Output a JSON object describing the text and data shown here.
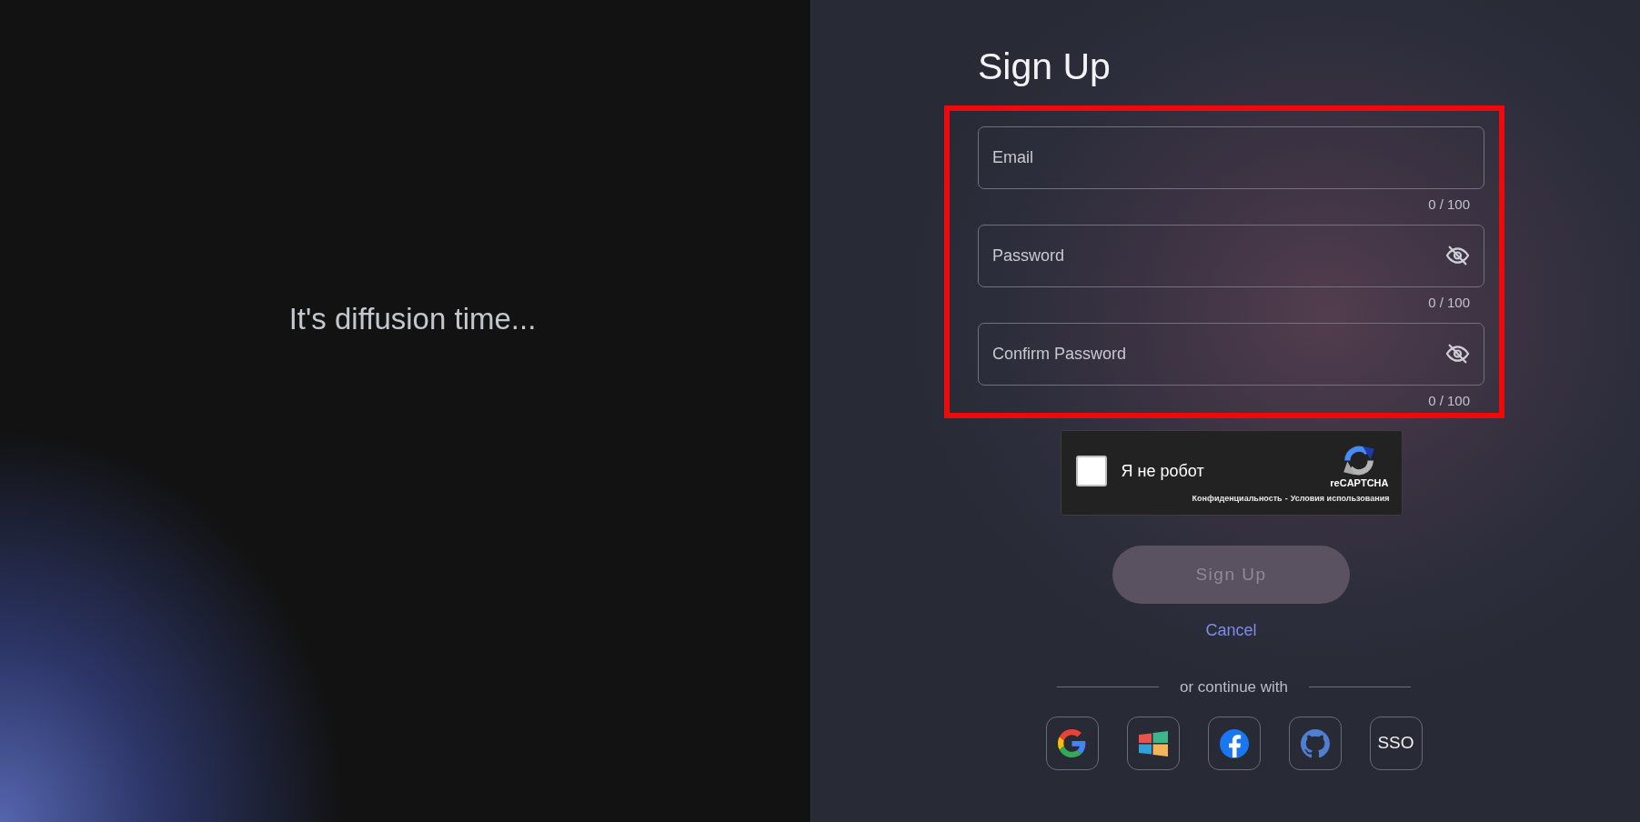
{
  "left_panel": {
    "tagline": "It's diffusion time..."
  },
  "form": {
    "title": "Sign Up",
    "fields_highlighted": true,
    "fields": [
      {
        "kind": "email",
        "placeholder": "Email",
        "counter": "0 / 100"
      },
      {
        "kind": "password",
        "placeholder": "Password",
        "counter": "0 / 100"
      },
      {
        "kind": "password",
        "placeholder": "Confirm Password",
        "counter": "0 / 100"
      }
    ],
    "captcha": {
      "checked": false,
      "label": "Я не робот",
      "brand": "reCAPTCHA",
      "links": [
        "Конфиденциальность",
        "Условия использования"
      ],
      "separator": "-"
    },
    "submit": {
      "label": "Sign Up",
      "disabled": true
    },
    "cancel": "Cancel",
    "divider": "or continue with",
    "providers": [
      {
        "kind": "google"
      },
      {
        "kind": "windows"
      },
      {
        "kind": "facebook"
      },
      {
        "kind": "github"
      },
      {
        "kind": "sso",
        "label": "SSO"
      }
    ]
  }
}
